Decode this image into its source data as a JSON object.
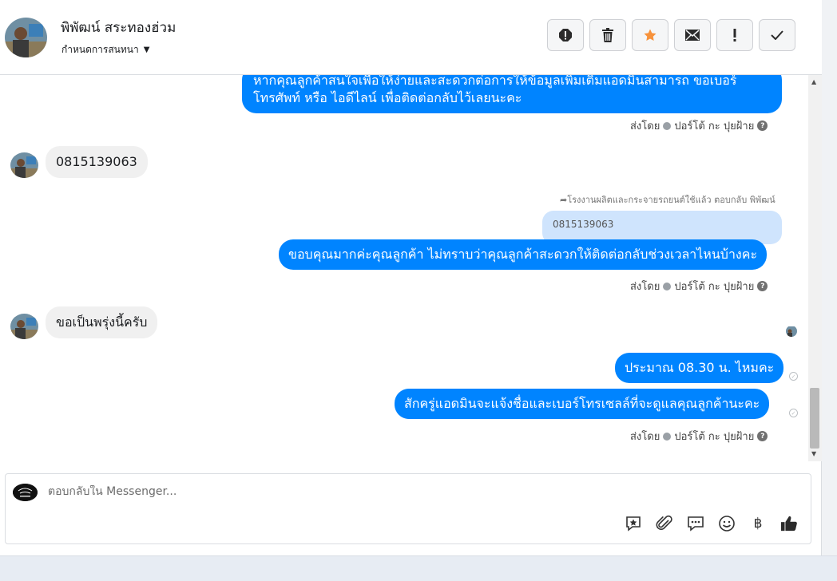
{
  "header": {
    "contact_name": "พิพัฒน์ สระทองฮ่วม",
    "assign_label": "กำหนดการสนทนา"
  },
  "messages": {
    "m1_text_line1": "หากคุณลูกค้าสนใจเพื่อให้ง่ายและสะดวกต่อการให้ข้อมูลเพิ่มเติมแอดมินสามารถ ขอเบอร์",
    "m1_text_line2": "โทรศัพท์ หรือ ไอดีไลน์ เพื่อติดต่อกลับไว้เลยนะคะ",
    "sent_by_label": "ส่งโดย",
    "sender_name": "ปอร์โต้ กะ ปุยฝ้าย",
    "in1_text": "0815139063",
    "reply_label": "โรงงานผลิตและกระจายรถยนต์ใช้แล้ว ตอบกลับ พิพัฒน์",
    "quoted_text": "0815139063",
    "out2_text": "ขอบคุณมากค่ะคุณลูกค้า ไม่ทราบว่าคุณลูกค้าสะดวกให้ติดต่อกลับช่วงเวลาไหนบ้างคะ",
    "in2_text": "ขอเป็นพรุ่งนี้ครับ",
    "out3_text": "ประมาณ 08.30 น. ไหมคะ",
    "out4_text": "สักครู่แอดมินจะแจ้งชื่อและเบอร์โทรเซลล์ที่จะดูแลคุณลูกค้านะคะ"
  },
  "composer": {
    "placeholder": "ตอบกลับใน Messenger..."
  },
  "icons": {
    "header_actions": [
      "exclamation-circle-icon",
      "trash-icon",
      "star-icon",
      "envelope-icon",
      "exclamation-icon",
      "checkmark-icon"
    ],
    "composer_tools": [
      "saved-reply-icon",
      "paperclip-icon",
      "chat-bubble-icon",
      "emoji-icon",
      "baht-icon",
      "thumbs-up-icon"
    ]
  },
  "colors": {
    "outgoing_bubble": "#0084ff",
    "incoming_bubble": "#f0f0f0",
    "star": "#f7923b"
  }
}
